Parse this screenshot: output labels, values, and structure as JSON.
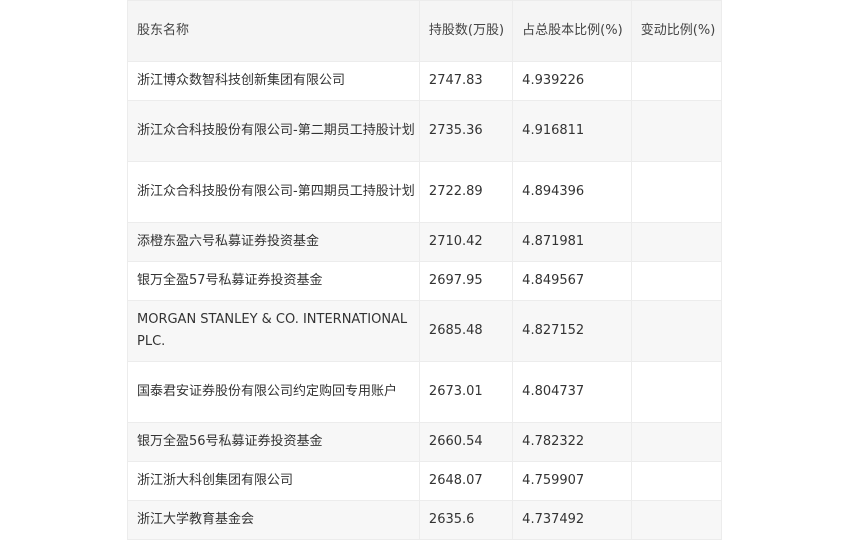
{
  "table": {
    "headers": [
      "股东名称",
      "持股数(万股)",
      "占总股本比例(%)",
      "变动比例(%)"
    ],
    "rows": [
      [
        "浙江博众数智科技创新集团有限公司",
        "2747.83",
        "4.939226",
        ""
      ],
      [
        "浙江众合科技股份有限公司-第二期员工持股计划",
        "2735.36",
        "4.916811",
        ""
      ],
      [
        "浙江众合科技股份有限公司-第四期员工持股计划",
        "2722.89",
        "4.894396",
        ""
      ],
      [
        "添橙东盈六号私募证券投资基金",
        "2710.42",
        "4.871981",
        ""
      ],
      [
        "银万全盈57号私募证券投资基金",
        "2697.95",
        "4.849567",
        ""
      ],
      [
        "MORGAN STANLEY & CO. INTERNATIONAL PLC.",
        "2685.48",
        "4.827152",
        ""
      ],
      [
        "国泰君安证券股份有限公司约定购回专用账户",
        "2673.01",
        "4.804737",
        ""
      ],
      [
        "银万全盈56号私募证券投资基金",
        "2660.54",
        "4.782322",
        ""
      ],
      [
        "浙江浙大科创集团有限公司",
        "2648.07",
        "4.759907",
        ""
      ],
      [
        "浙江大学教育基金会",
        "2635.6",
        "4.737492",
        ""
      ]
    ]
  }
}
